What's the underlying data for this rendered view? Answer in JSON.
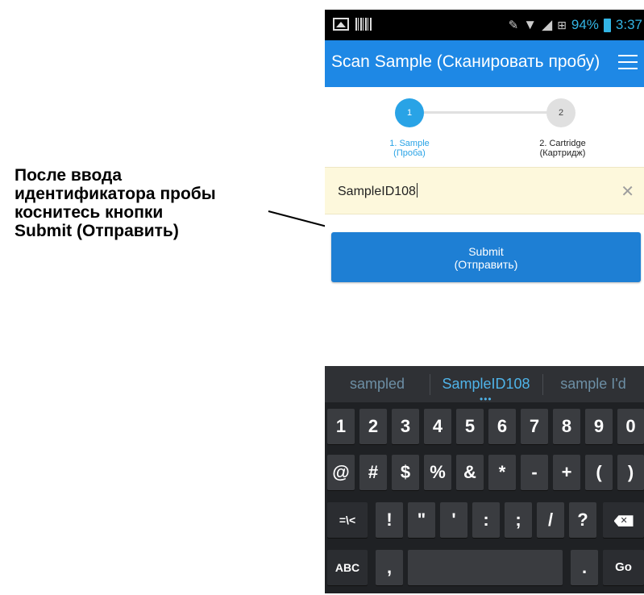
{
  "callout": {
    "lines": [
      "После ввода",
      "идентификатора пробы",
      "коснитесь кнопки",
      "Submit (Отправить)"
    ]
  },
  "status_bar": {
    "battery": "94%",
    "time": "3:37"
  },
  "app_bar": {
    "title": "Scan Sample (Сканировать пробу)"
  },
  "stepper": {
    "steps": [
      {
        "number": "1",
        "label": "1. Sample",
        "sublabel": "(Проба)",
        "active": true
      },
      {
        "number": "2",
        "label": "2. Cartridge",
        "sublabel": "(Картридж)",
        "active": false
      }
    ]
  },
  "sample_input": {
    "value": "SampleID108",
    "clear_icon": "close-icon"
  },
  "submit_button": {
    "label": "Submit",
    "sublabel": "(Отправить)"
  },
  "keyboard": {
    "suggestions": [
      "sampled",
      "SampleID108",
      "sample I'd"
    ],
    "row1": [
      "1",
      "2",
      "3",
      "4",
      "5",
      "6",
      "7",
      "8",
      "9",
      "0"
    ],
    "row2": [
      "@",
      "#",
      "$",
      "%",
      "&",
      "*",
      "-",
      "+",
      "(",
      ")"
    ],
    "row3": [
      "=\\<",
      "!",
      "\"",
      "'",
      ":",
      ";",
      "/",
      "?"
    ],
    "abc_label": "ABC",
    "comma": ",",
    "period": ".",
    "go_label": "Go"
  },
  "colors": {
    "app_bar": "#1e88e5",
    "accent": "#29a3e6",
    "input_background": "#fdf8dc",
    "submit": "#1e7fd4"
  }
}
